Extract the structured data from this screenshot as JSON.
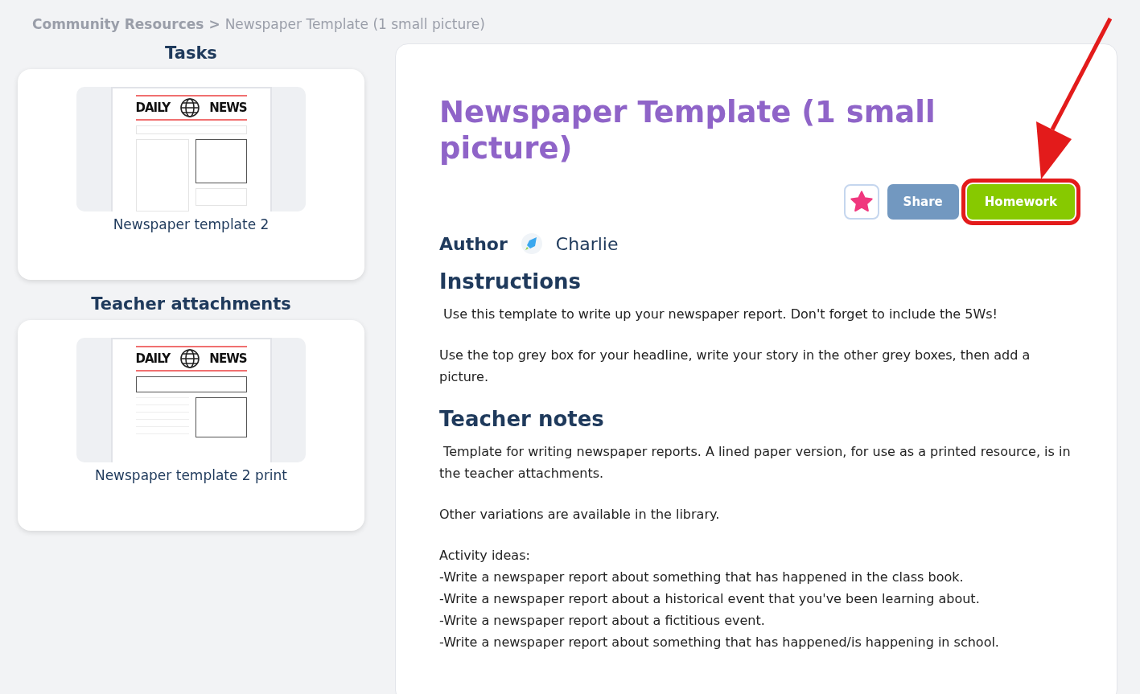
{
  "breadcrumb": {
    "parent": "Community Resources",
    "separator": ">",
    "current": "Newspaper Template (1 small picture)"
  },
  "sections": [
    {
      "heading": "Tasks",
      "file": {
        "name": "Newspaper template 2",
        "masthead_left": "DAILY",
        "masthead_right": "NEWS",
        "kind": "boxes"
      }
    },
    {
      "heading": "Teacher attachments",
      "file": {
        "name": "Newspaper template 2 print",
        "masthead_left": "DAILY",
        "masthead_right": "NEWS",
        "kind": "lined"
      }
    }
  ],
  "resource": {
    "title": "Newspaper Template (1 small picture)",
    "favourite": true,
    "buttons": [
      {
        "label": "Share",
        "kind": "share",
        "highlighted": false
      },
      {
        "label": "Homework",
        "kind": "homework",
        "highlighted": true
      }
    ],
    "author_label": "Author",
    "author": "Charlie",
    "blocks": [
      {
        "heading": "Instructions",
        "paragraphs": [
          " Use this template to write up your newspaper report. Don't forget to include the 5Ws!",
          "Use the top grey box for your headline, write your story in the other grey boxes, then add a picture."
        ]
      },
      {
        "heading": "Teacher notes",
        "paragraphs": [
          " Template for writing newspaper reports. A lined paper version, for use as a printed resource, is in the teacher attachments.",
          "Other variations are available in the library.",
          "Activity ideas:\n-Write a newspaper report about something that has happened in the class book.\n-Write a newspaper report about a historical event that you've been learning about.\n-Write a newspaper report about a fictitious event.\n-Write a newspaper report about something that has happened/is happening in school."
        ]
      }
    ]
  }
}
